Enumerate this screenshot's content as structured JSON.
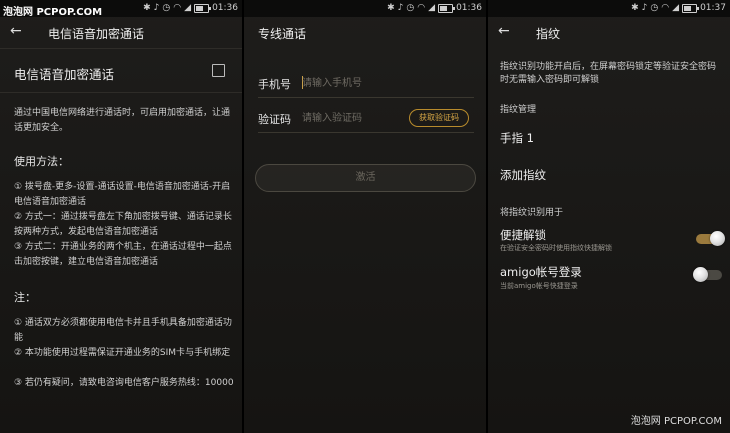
{
  "watermark": {
    "top_left": "泡泡网 PCPOP.COM",
    "bottom_right": "泡泡网 PCPOP.COM"
  },
  "statusbar": {
    "icons": [
      "bluetooth-icon",
      "mute-icon",
      "alarm-icon",
      "wifi-icon",
      "signal-icon",
      "battery-icon"
    ],
    "p1_time": "01:36",
    "p2_time": "01:36",
    "p3_time": "01:37"
  },
  "panel1": {
    "title": "电信语音加密通话",
    "heading": "电信语音加密通话",
    "intro": "通过中国电信网络进行通话时，可启用加密通话，让通话更加安全。",
    "usage_title": "使用方法：",
    "usage_lines": [
      "① 拨号盘-更多-设置-通话设置-电信语音加密通话-开启电信语音加密通话",
      "② 方式一：通过拨号盘左下角加密拨号键、通话记录长按两种方式，发起电信语音加密通话",
      "③ 方式二：开通业务的两个机主，在通话过程中一起点击加密按键，建立电信语音加密通话"
    ],
    "note_title": "注：",
    "note_lines": [
      "① 通话双方必须都使用电信卡并且手机具备加密通话功能",
      "② 本功能使用过程需保证开通业务的SIM卡与手机绑定",
      "③ 若仍有疑问，请致电咨询电信客户服务热线：10000"
    ]
  },
  "panel2": {
    "title": "专线通话",
    "phone_label": "手机号",
    "phone_placeholder": "请输入手机号",
    "code_label": "验证码",
    "code_placeholder": "请输入验证码",
    "get_code": "获取验证码",
    "activate": "激活"
  },
  "panel3": {
    "title": "指纹",
    "description": "指纹识别功能开启后，在屏幕密码锁定等验证安全密码时无需输入密码即可解锁",
    "manage_label": "指纹管理",
    "finger1": "手指 1",
    "add_fingerprint": "添加指纹",
    "use_for_label": "将指纹识别用于",
    "quick_unlock": "便捷解锁",
    "quick_unlock_sub": "在验证安全密码时使用指纹快捷解锁",
    "quick_unlock_on": true,
    "amigo_login": "amigo帐号登录",
    "amigo_login_sub": "当前amigo帐号快捷登录",
    "amigo_login_on": false
  }
}
